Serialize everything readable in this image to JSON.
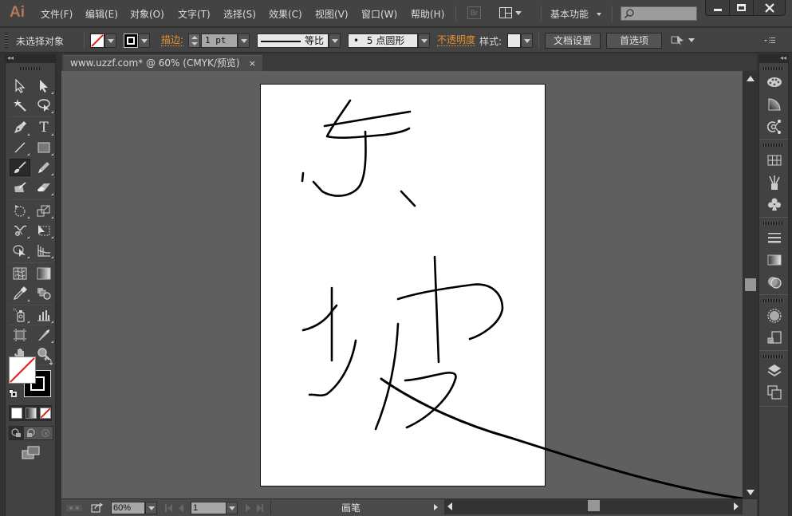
{
  "app": {
    "logo": "Ai"
  },
  "menu": [
    {
      "label": "文件(F)"
    },
    {
      "label": "编辑(E)"
    },
    {
      "label": "对象(O)"
    },
    {
      "label": "文字(T)"
    },
    {
      "label": "选择(S)"
    },
    {
      "label": "效果(C)"
    },
    {
      "label": "视图(V)"
    },
    {
      "label": "窗口(W)"
    },
    {
      "label": "帮助(H)"
    }
  ],
  "titlebar": {
    "bridge_label": "Br",
    "workspace": "基本功能",
    "search_placeholder": "",
    "window_buttons": [
      "minimize",
      "maximize",
      "close"
    ]
  },
  "control": {
    "selection_status": "未选择对象",
    "stroke_label": "描边:",
    "stroke_weight": "1 pt",
    "profile_label": "等比",
    "brush_label": "5 点圆形",
    "opacity_label": "不透明度",
    "style_label": "样式:",
    "doc_setup": "文档设置",
    "preferences": "首选项"
  },
  "document": {
    "tab_title": "www.uzzf.com* @ 60% (CMYK/预览)",
    "close_glyph": "×"
  },
  "tools": [
    {
      "name": "selection"
    },
    {
      "name": "direct-selection"
    },
    {
      "name": "magic-wand"
    },
    {
      "name": "lasso"
    },
    {
      "name": "pen"
    },
    {
      "name": "type"
    },
    {
      "name": "line-segment"
    },
    {
      "name": "rectangle"
    },
    {
      "name": "paintbrush",
      "active": true
    },
    {
      "name": "pencil"
    },
    {
      "name": "blob-brush"
    },
    {
      "name": "eraser"
    },
    {
      "name": "rotate"
    },
    {
      "name": "scale"
    },
    {
      "name": "puppet-warp"
    },
    {
      "name": "free-transform"
    },
    {
      "name": "shape-builder"
    },
    {
      "name": "perspective-grid"
    },
    {
      "name": "mesh"
    },
    {
      "name": "gradient"
    },
    {
      "name": "eyedropper"
    },
    {
      "name": "blend"
    },
    {
      "name": "symbol-sprayer"
    },
    {
      "name": "column-graph"
    },
    {
      "name": "artboard"
    },
    {
      "name": "slice"
    },
    {
      "name": "hand"
    },
    {
      "name": "zoom"
    }
  ],
  "colors": {
    "fill": "none",
    "stroke": "#000000",
    "accent_orange": "#e89030",
    "none_red": "#e0201a"
  },
  "status": {
    "zoom": "60%",
    "artboard_number": "1",
    "tool_name": "画笔"
  },
  "right_panels": [
    "color-icon",
    "color-guide-icon",
    "appearance-icon",
    "swatches-icon",
    "brushes-icon",
    "symbols-icon",
    "stroke-icon",
    "gradient-icon",
    "transparency-icon",
    "graphic-styles-icon",
    "artboards-icon",
    "layers-icon",
    "artboards-panel-icon"
  ]
}
